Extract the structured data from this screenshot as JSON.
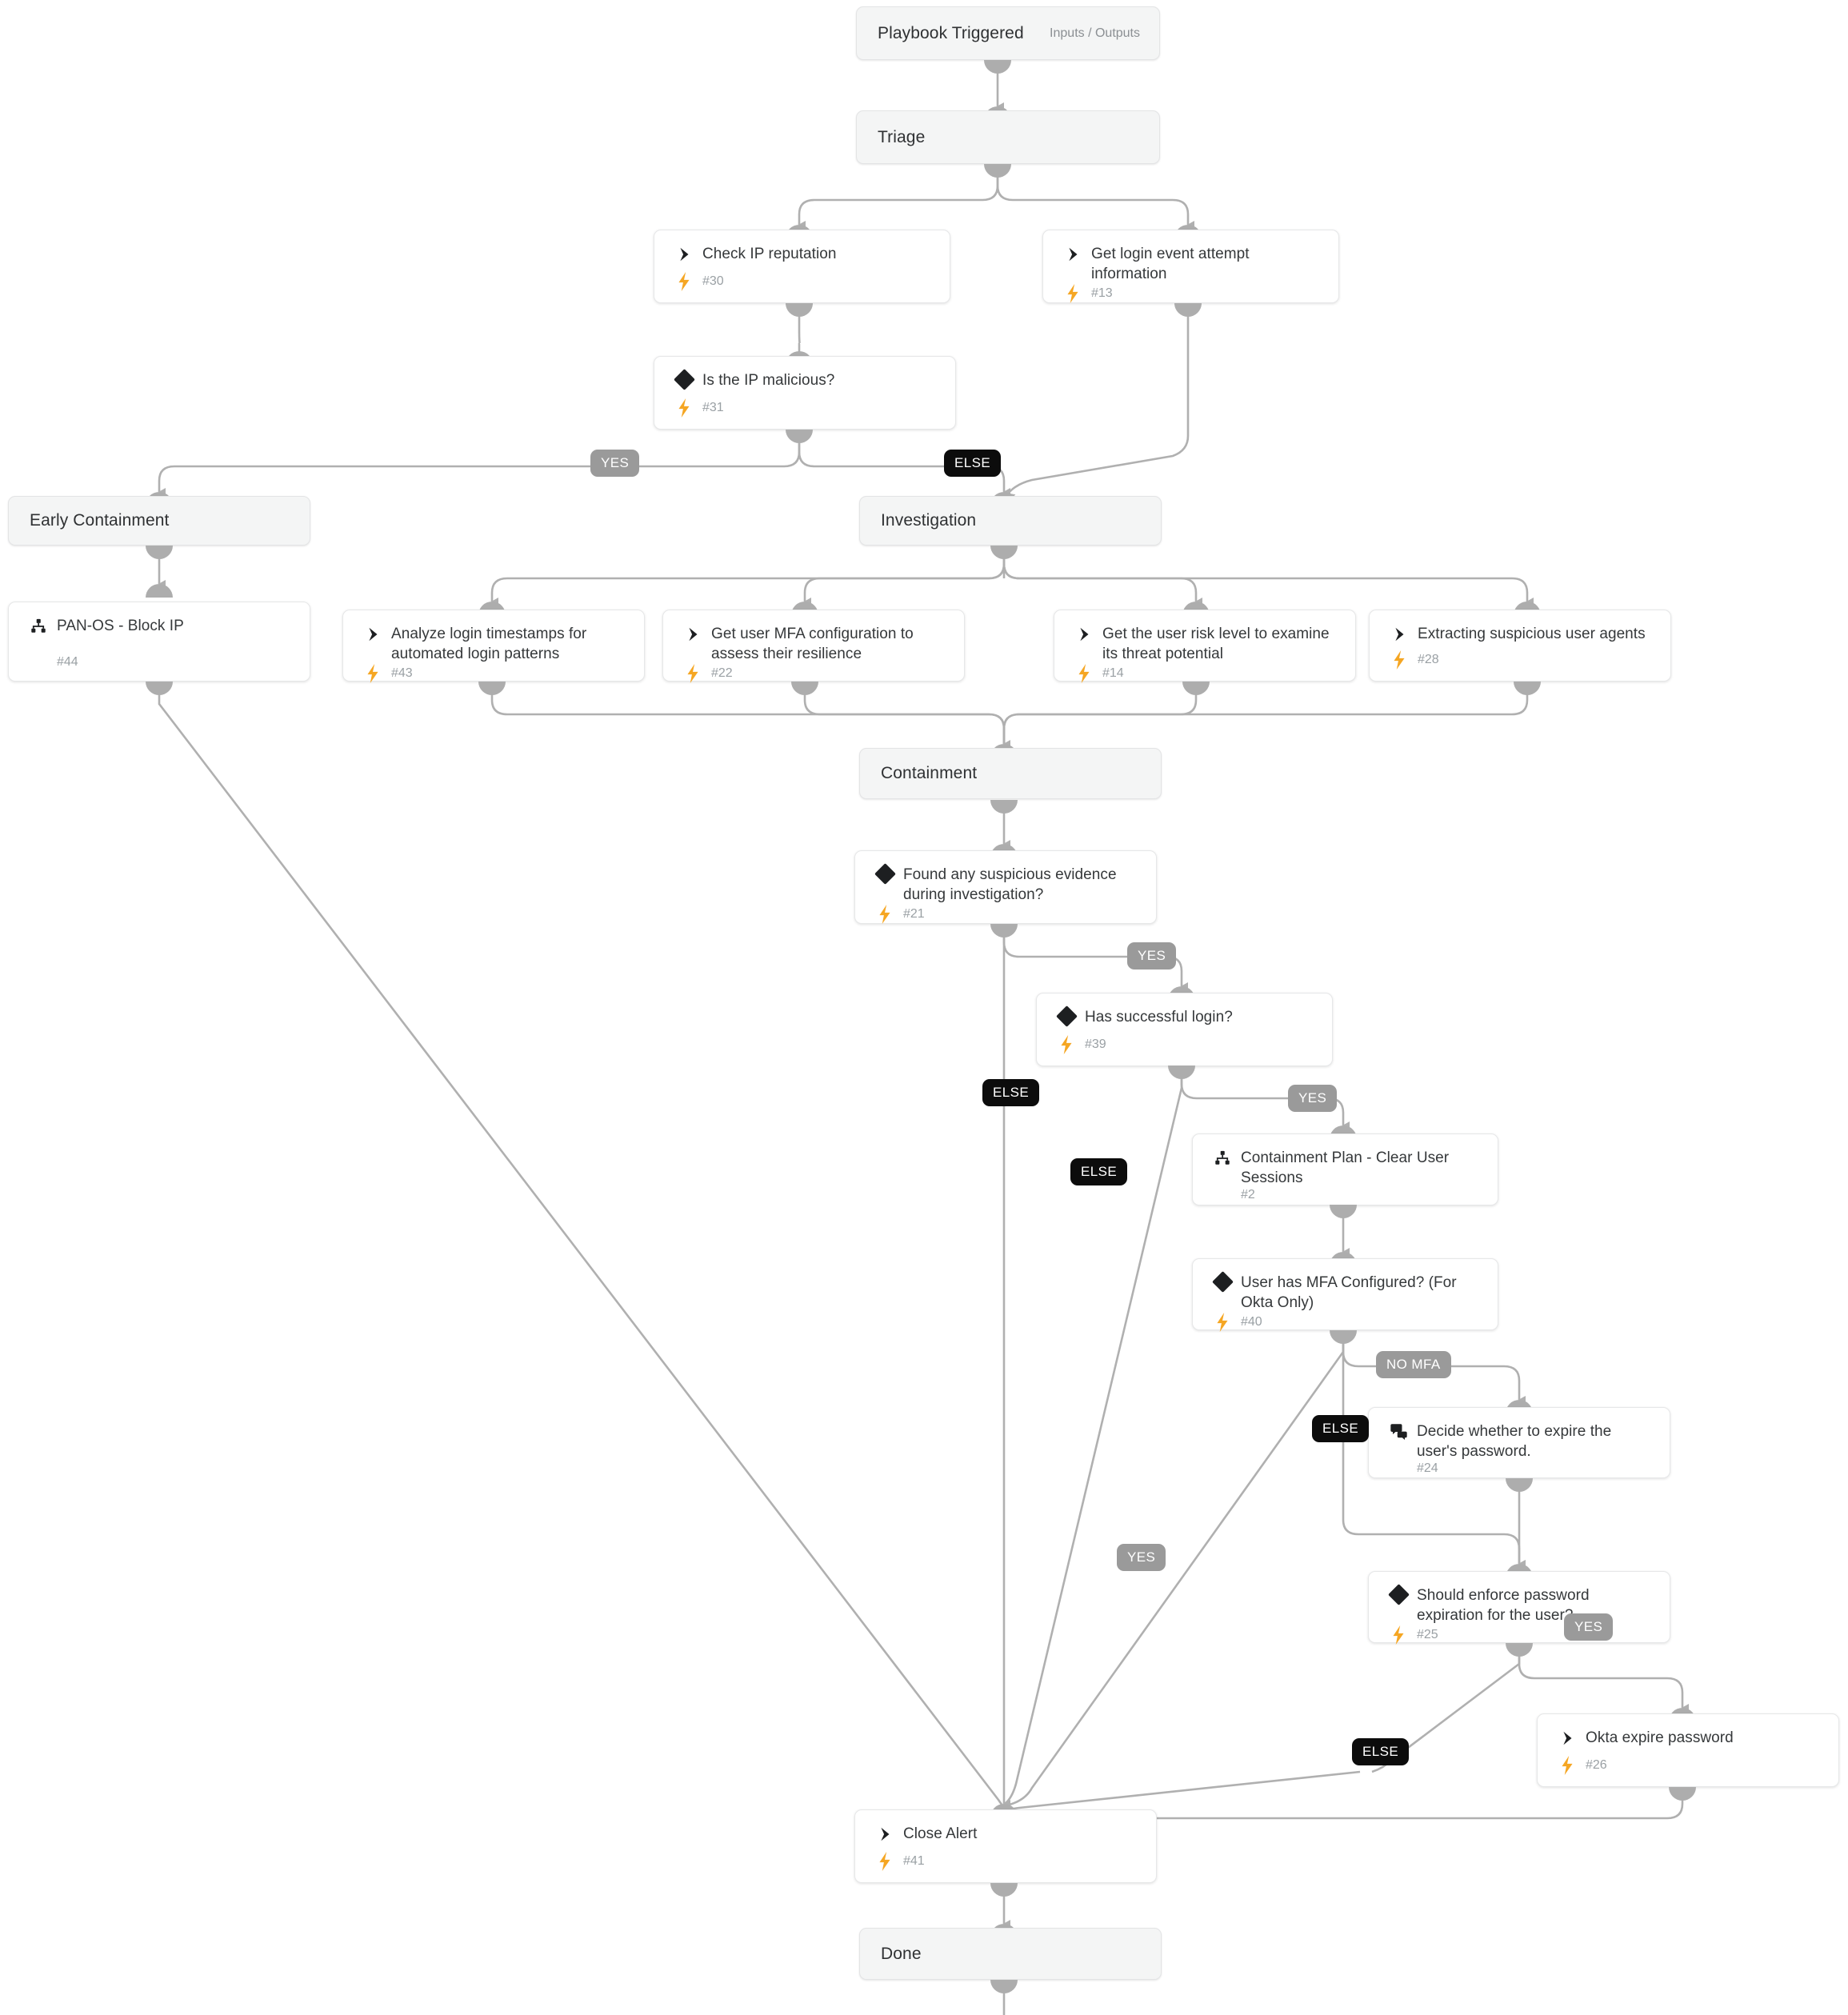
{
  "diagram": {
    "type": "playbook-workflow",
    "title": "Playbook Triggered",
    "colors": {
      "phase_bg": "#f4f5f5",
      "card_bg": "#ffffff",
      "border": "#e6e7e8",
      "edge": "#b0b0b0",
      "port": "#adadad",
      "bolt": "#f5a623",
      "yes_pill": "#9a9a9a",
      "else_pill": "#0c0c0c",
      "text": "#35383a",
      "muted": "#9aa0a4"
    }
  },
  "phases": [
    {
      "id": "trigger",
      "label": "Playbook Triggered",
      "meta": "Inputs / Outputs"
    },
    {
      "id": "triage",
      "label": "Triage",
      "meta": ""
    },
    {
      "id": "early",
      "label": "Early Containment",
      "meta": ""
    },
    {
      "id": "invest",
      "label": "Investigation",
      "meta": ""
    },
    {
      "id": "contain",
      "label": "Containment",
      "meta": ""
    },
    {
      "id": "done",
      "label": "Done",
      "meta": ""
    }
  ],
  "nodes": [
    {
      "id": "n30",
      "title": "Check IP reputation",
      "num": "#30",
      "icon": "chevron-icon",
      "bolt": true
    },
    {
      "id": "n13",
      "title": "Get login event attempt information",
      "num": "#13",
      "icon": "chevron-icon",
      "bolt": true
    },
    {
      "id": "n31",
      "title": "Is the IP malicious?",
      "num": "#31",
      "icon": "diamond-icon",
      "bolt": true
    },
    {
      "id": "n44",
      "title": "PAN-OS - Block IP",
      "num": "#44",
      "icon": "subplaybook-icon",
      "bolt": false
    },
    {
      "id": "n43",
      "title": "Analyze login timestamps for automated login patterns",
      "num": "#43",
      "icon": "chevron-icon",
      "bolt": true
    },
    {
      "id": "n22",
      "title": "Get user MFA configuration to assess their resilience",
      "num": "#22",
      "icon": "chevron-icon",
      "bolt": true
    },
    {
      "id": "n14",
      "title": "Get the user risk level to examine its threat potential",
      "num": "#14",
      "icon": "chevron-icon",
      "bolt": true
    },
    {
      "id": "n28",
      "title": "Extracting suspicious user agents",
      "num": "#28",
      "icon": "chevron-icon",
      "bolt": true
    },
    {
      "id": "n21",
      "title": "Found any suspicious evidence during investigation?",
      "num": "#21",
      "icon": "diamond-icon",
      "bolt": true
    },
    {
      "id": "n39",
      "title": "Has successful login?",
      "num": "#39",
      "icon": "diamond-icon",
      "bolt": true
    },
    {
      "id": "n2",
      "title": "Containment Plan - Clear User Sessions",
      "num": "#2",
      "icon": "subplaybook-icon",
      "bolt": false
    },
    {
      "id": "n40",
      "title": "User has MFA Configured? (For Okta Only)",
      "num": "#40",
      "icon": "diamond-icon",
      "bolt": true
    },
    {
      "id": "n24",
      "title": "Decide whether to expire the user's password.",
      "num": "#24",
      "icon": "data-collection-icon",
      "bolt": false
    },
    {
      "id": "n25",
      "title": "Should enforce password expiration for the user?",
      "num": "#25",
      "icon": "diamond-icon",
      "bolt": true
    },
    {
      "id": "n26",
      "title": "Okta expire password",
      "num": "#26",
      "icon": "chevron-icon",
      "bolt": true
    },
    {
      "id": "n41",
      "title": "Close Alert",
      "num": "#41",
      "icon": "chevron-icon",
      "bolt": true
    }
  ],
  "branch_labels": [
    {
      "id": "b1",
      "text": "YES",
      "kind": "yes"
    },
    {
      "id": "b2",
      "text": "ELSE",
      "kind": "else"
    },
    {
      "id": "b3",
      "text": "YES",
      "kind": "yes"
    },
    {
      "id": "b4",
      "text": "ELSE",
      "kind": "else"
    },
    {
      "id": "b5",
      "text": "YES",
      "kind": "yes"
    },
    {
      "id": "b6",
      "text": "ELSE",
      "kind": "else"
    },
    {
      "id": "b7",
      "text": "NO MFA",
      "kind": "nomfa"
    },
    {
      "id": "b8",
      "text": "ELSE",
      "kind": "else"
    },
    {
      "id": "b9",
      "text": "YES",
      "kind": "yes"
    },
    {
      "id": "b10",
      "text": "YES",
      "kind": "yes"
    },
    {
      "id": "b11",
      "text": "ELSE",
      "kind": "else"
    }
  ]
}
